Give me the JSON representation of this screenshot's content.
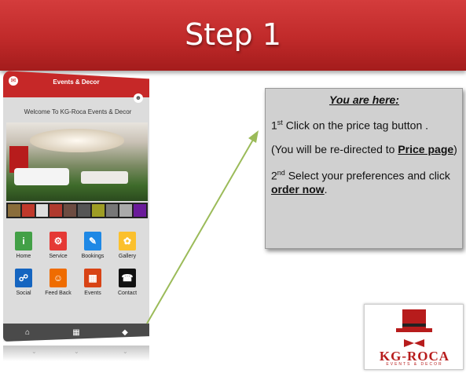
{
  "slide": {
    "title": "Step 1"
  },
  "app": {
    "header_title": "Events & Decor",
    "welcome": "Welcome To KG-Roca Events & Decor",
    "thumb_colors": [
      "#8a6d3b",
      "#c0392b",
      "#ddd",
      "#b03a2e",
      "#6d4c41",
      "#555",
      "#9e9d24",
      "#777",
      "#aaa",
      "#6a1b9a"
    ],
    "tiles": [
      {
        "label": "Home",
        "icon": "info-icon",
        "glyph": "i",
        "color": "#43a047"
      },
      {
        "label": "Service",
        "icon": "gears-icon",
        "glyph": "⚙",
        "color": "#e53935"
      },
      {
        "label": "Bookings",
        "icon": "notepad-icon",
        "glyph": "✎",
        "color": "#1e88e5"
      },
      {
        "label": "Gallery",
        "icon": "sunflower-icon",
        "glyph": "✿",
        "color": "#fbc02d"
      },
      {
        "label": "Social",
        "icon": "network-icon",
        "glyph": "☍",
        "color": "#1565c0"
      },
      {
        "label": "Feed Back",
        "icon": "people-icon",
        "glyph": "☺",
        "color": "#ef6c00"
      },
      {
        "label": "Events",
        "icon": "calendar-icon",
        "glyph": "▦",
        "color": "#d84315"
      },
      {
        "label": "Contact",
        "icon": "phone-icon",
        "glyph": "☎",
        "color": "#111111"
      }
    ]
  },
  "info": {
    "heading": "You are here:",
    "step1_num": "1",
    "step1_sup": "st",
    "step1_text": " Click on the price tag button .",
    "redirect_pre": "(You will be re-directed to ",
    "redirect_link": "Price page",
    "redirect_post": ")",
    "step2_num": "2",
    "step2_sup": "nd",
    "step2_text": "  Select your preferences and click ",
    "order_link": "order now",
    "step2_end": "."
  },
  "logo": {
    "name": "KG-ROCA",
    "sub": "EVENTS & DECOR"
  }
}
